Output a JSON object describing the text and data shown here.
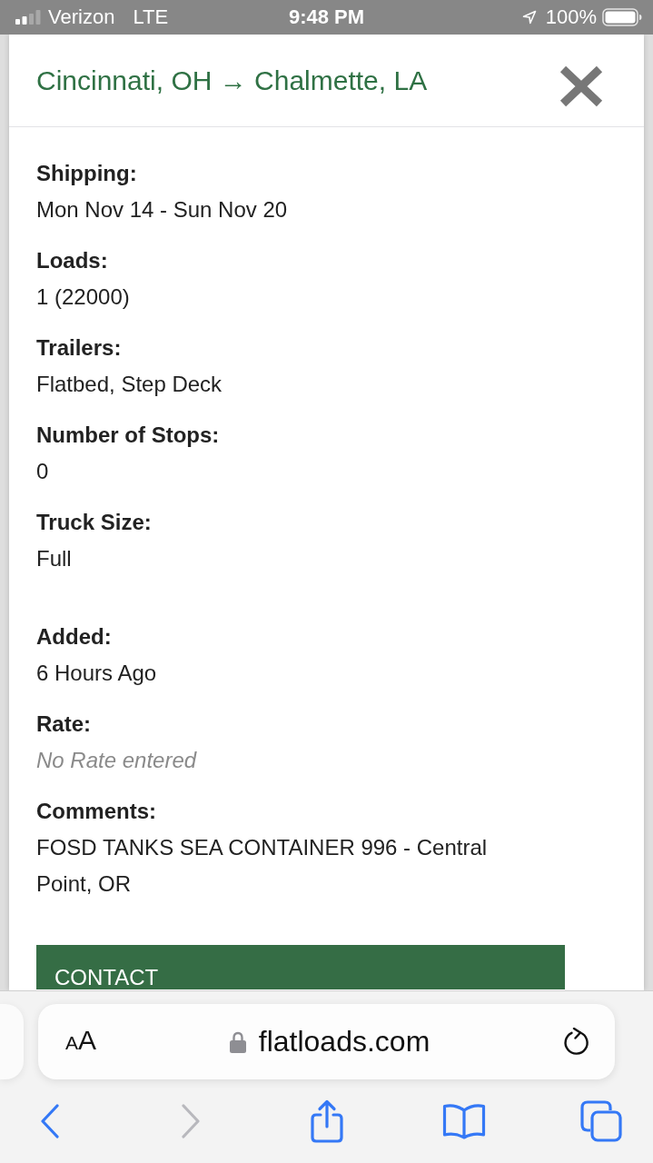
{
  "status_bar": {
    "carrier": "Verizon",
    "network": "LTE",
    "time": "9:48 PM",
    "battery": "100%"
  },
  "modal": {
    "title": "Cincinnati, OH → Chalmette, LA",
    "field_groups": [
      {
        "fields": [
          {
            "label": "Shipping:",
            "value": "Mon Nov 14 - Sun Nov 20",
            "kind": "text"
          },
          {
            "label": "Loads:",
            "value": "1 (22000)",
            "kind": "text"
          },
          {
            "label": "Trailers:",
            "value": "Flatbed, Step Deck",
            "kind": "text"
          },
          {
            "label": "Number of Stops:",
            "value": "0",
            "kind": "text"
          },
          {
            "label": "Truck Size:",
            "value": "Full",
            "kind": "text"
          }
        ]
      },
      {
        "fields": [
          {
            "label": "Added:",
            "value": "6 Hours Ago",
            "kind": "text"
          },
          {
            "label": "Rate:",
            "value": "No Rate entered",
            "kind": "note"
          },
          {
            "label": "Comments:",
            "value": "FOSD TANKS SEA CONTAINER 996 - Central Point, OR",
            "kind": "text"
          }
        ]
      }
    ],
    "contact_button": "CONTACT"
  },
  "browser": {
    "text_size_button": "AA",
    "url": "flatloads.com",
    "toolbar": [
      {
        "kind": "back",
        "disabled": false
      },
      {
        "kind": "forward",
        "disabled": true
      },
      {
        "kind": "share",
        "disabled": false
      },
      {
        "kind": "bookmarks",
        "disabled": false
      },
      {
        "kind": "tabs",
        "disabled": false
      }
    ]
  }
}
